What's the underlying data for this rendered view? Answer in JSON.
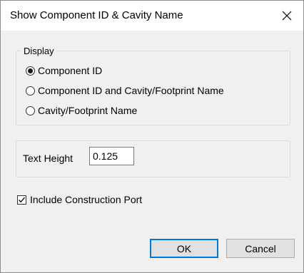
{
  "window": {
    "title": "Show Component ID & Cavity Name"
  },
  "display_group": {
    "legend": "Display",
    "options": [
      {
        "label": "Component ID",
        "selected": true
      },
      {
        "label": "Component ID and Cavity/Footprint Name",
        "selected": false
      },
      {
        "label": "Cavity/Footprint Name",
        "selected": false
      }
    ]
  },
  "text_height": {
    "label": "Text Height",
    "value": "0.125"
  },
  "construction_port": {
    "label": "Include Construction Port",
    "checked": true
  },
  "buttons": {
    "ok": "OK",
    "cancel": "Cancel"
  },
  "icons": {
    "close": "close-icon",
    "radio": "radio-button",
    "check": "checkmark-icon"
  }
}
